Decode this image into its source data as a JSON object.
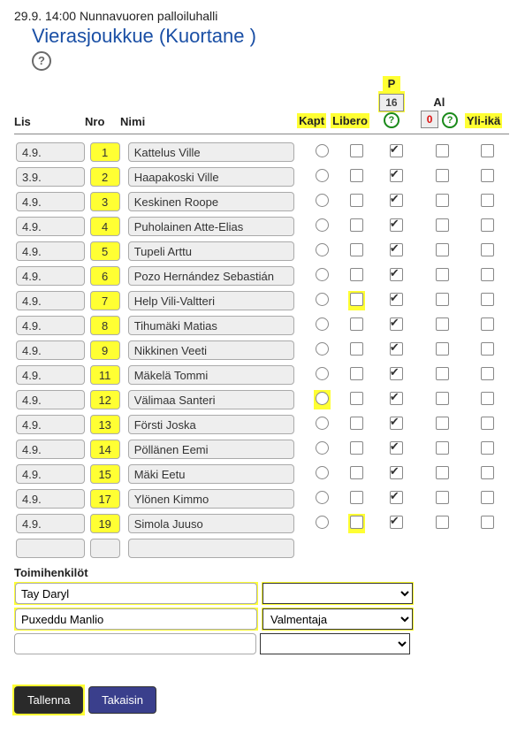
{
  "match_info": "29.9. 14:00 Nunnavuoren palloiluhalli",
  "team_heading": "Vierasjoukkue (Kuortane )",
  "headers": {
    "lis": "Lis",
    "nro": "Nro",
    "nimi": "Nimi",
    "kapt": "Kapt",
    "libero": "Libero",
    "p": "P",
    "al": "Al",
    "yli": "Yli-ikä"
  },
  "counts": {
    "p": "16",
    "al": "0"
  },
  "players": [
    {
      "lis": "4.9.",
      "nro": "1",
      "nimi": "Kattelus Ville",
      "p": true
    },
    {
      "lis": "3.9.",
      "nro": "2",
      "nimi": "Haapakoski Ville",
      "p": true
    },
    {
      "lis": "4.9.",
      "nro": "3",
      "nimi": "Keskinen Roope",
      "p": true
    },
    {
      "lis": "4.9.",
      "nro": "4",
      "nimi": "Puholainen Atte-Elias",
      "p": true
    },
    {
      "lis": "4.9.",
      "nro": "5",
      "nimi": "Tupeli Arttu",
      "p": true
    },
    {
      "lis": "4.9.",
      "nro": "6",
      "nimi": "Pozo Hernández Sebastián",
      "p": true
    },
    {
      "lis": "4.9.",
      "nro": "7",
      "nimi": "Help Vili-Valtteri",
      "p": true,
      "libero_hl": true
    },
    {
      "lis": "4.9.",
      "nro": "8",
      "nimi": "Tihumäki Matias",
      "p": true
    },
    {
      "lis": "4.9.",
      "nro": "9",
      "nimi": "Nikkinen Veeti",
      "p": true
    },
    {
      "lis": "4.9.",
      "nro": "11",
      "nimi": "Mäkelä Tommi",
      "p": true
    },
    {
      "lis": "4.9.",
      "nro": "12",
      "nimi": "Välimaa Santeri",
      "p": true,
      "kapt_hl": true
    },
    {
      "lis": "4.9.",
      "nro": "13",
      "nimi": "Försti Joska",
      "p": true
    },
    {
      "lis": "4.9.",
      "nro": "14",
      "nimi": "Pöllänen Eemi",
      "p": true
    },
    {
      "lis": "4.9.",
      "nro": "15",
      "nimi": "Mäki Eetu",
      "p": true
    },
    {
      "lis": "4.9.",
      "nro": "17",
      "nimi": "Ylönen Kimmo",
      "p": true
    },
    {
      "lis": "4.9.",
      "nro": "19",
      "nimi": "Simola Juuso",
      "p": true,
      "libero_hl": true
    },
    {
      "lis": "",
      "nro": "",
      "nimi": "",
      "p": false,
      "empty": true
    }
  ],
  "officials_section": "Toimihenkilöt",
  "officials": [
    {
      "name": "Tay Daryl",
      "role": "",
      "hl": true
    },
    {
      "name": "Puxeddu Manlio",
      "role": "Valmentaja",
      "hl": true
    },
    {
      "name": "",
      "role": "",
      "hl": false
    }
  ],
  "buttons": {
    "save": "Tallenna",
    "back": "Takaisin"
  }
}
